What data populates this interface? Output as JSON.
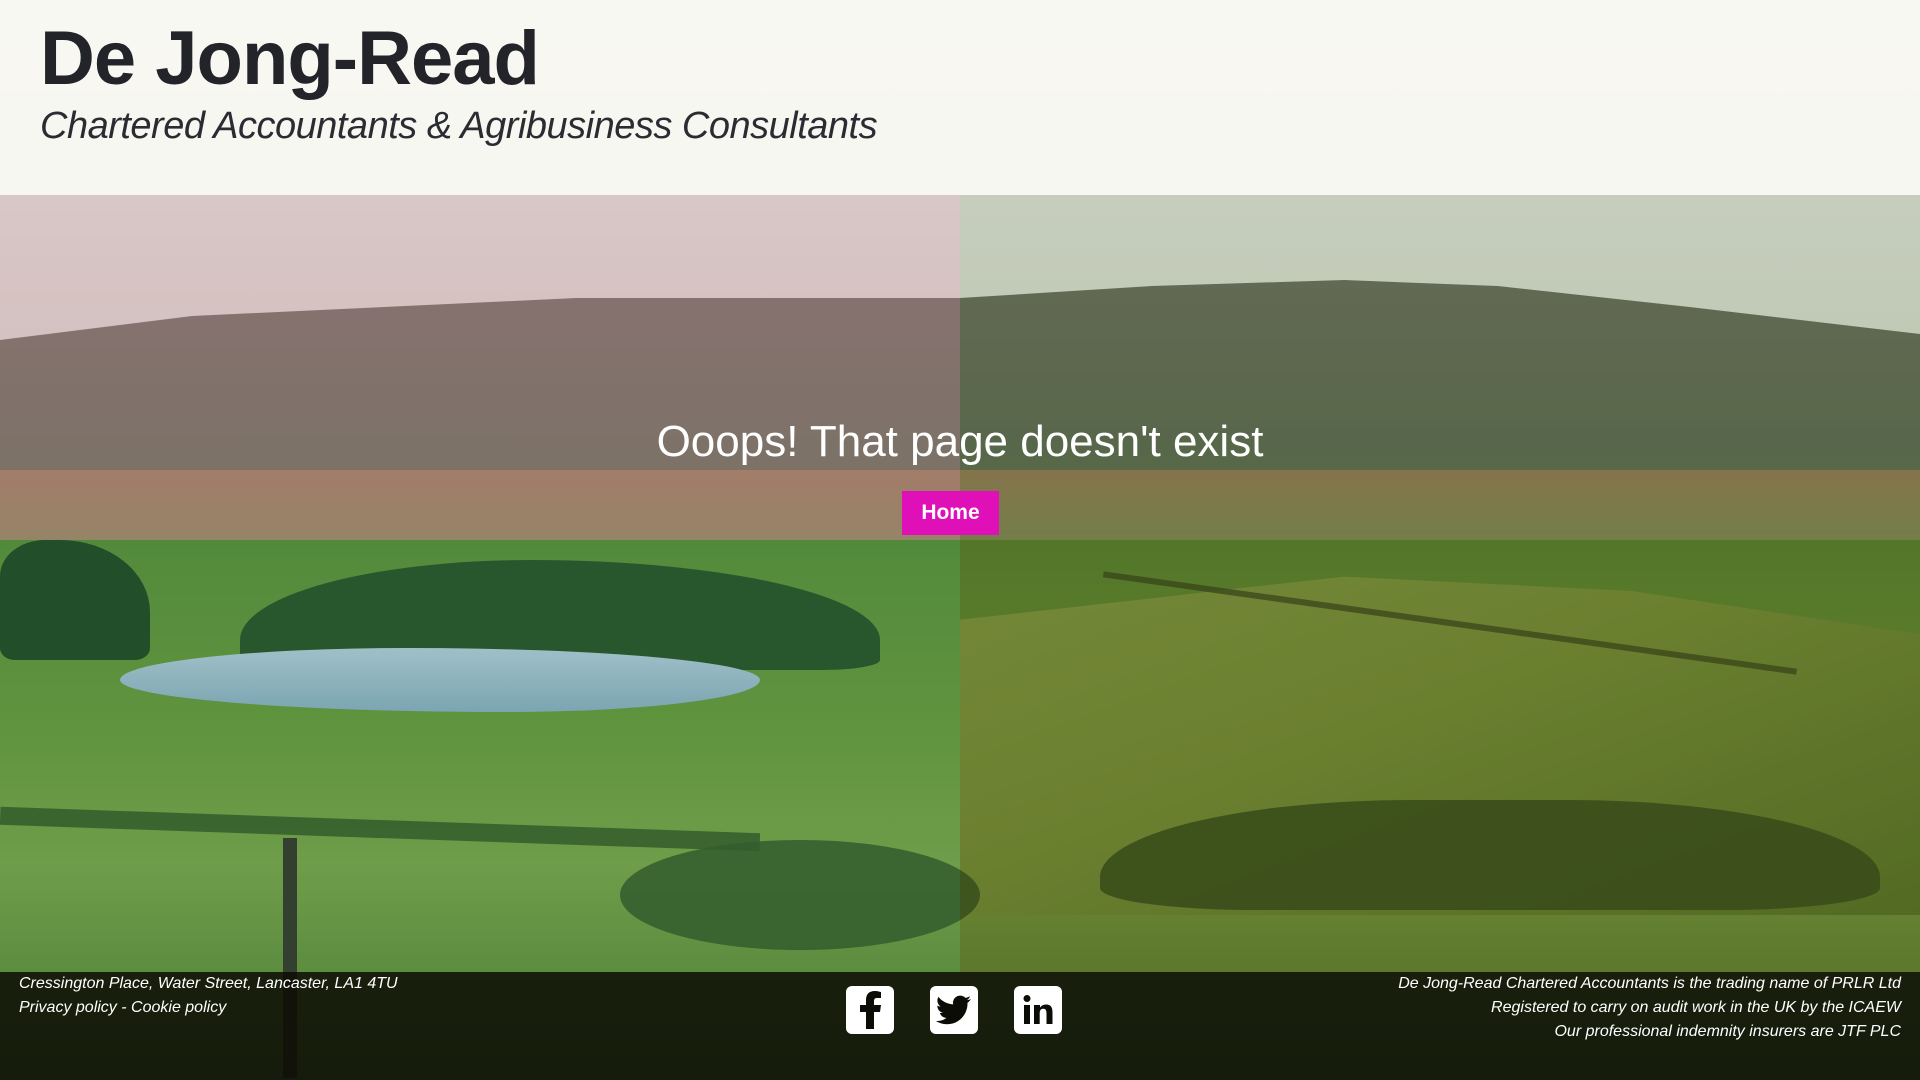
{
  "header": {
    "title": "De Jong-Read",
    "tagline": "Chartered Accountants & Agribusiness Consultants"
  },
  "main": {
    "message": "Ooops! That page doesn't exist",
    "home_button": "Home"
  },
  "footer": {
    "address": "Cressington Place, Water Street, Lancaster, LA1 4TU",
    "privacy_link": "Privacy policy",
    "separator": " - ",
    "cookie_link": "Cookie policy",
    "social": [
      {
        "icon": "facebook-icon"
      },
      {
        "icon": "twitter-icon"
      },
      {
        "icon": "linkedin-icon"
      }
    ],
    "right_lines": [
      "De Jong-Read Chartered Accountants is the trading name of PRLR Ltd",
      "Registered to carry on audit work in the UK by the ICAEW",
      "Our professional indemnity insurers are JTF PLC"
    ]
  },
  "colors": {
    "accent": "#e010b8",
    "title": "#22242a",
    "footer_bg": "#0c0c06"
  }
}
